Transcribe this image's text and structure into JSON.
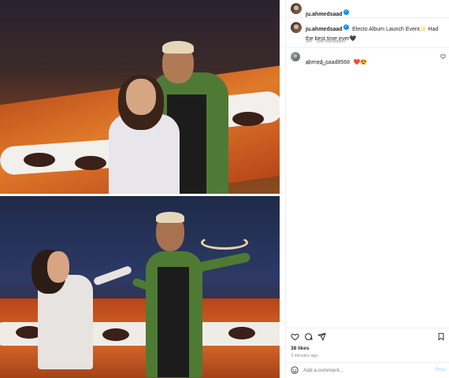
{
  "header": {
    "username": "ju.ahmedsaad",
    "verified": true
  },
  "caption": {
    "username": "ju.ahmedsaad",
    "text": "Electo Album Launch Event",
    "emoji": "✨",
    "text2": " Had the best time ever",
    "emoji2": "🖤",
    "time": "3m",
    "see_translation": "See translation"
  },
  "comments": [
    {
      "username": "ahmed_saad8568",
      "text": "❤️😍",
      "time": "2m",
      "reply": "Reply"
    }
  ],
  "actions": {
    "likes": "38 likes",
    "timestamp": "3 minutes ago"
  },
  "add_comment": {
    "placeholder": "Add a comment...",
    "post_label": "Post"
  },
  "icons": {
    "more": "more-options-icon",
    "heart": "heart-icon",
    "comment": "comment-icon",
    "share": "share-icon",
    "save": "bookmark-icon",
    "emoji": "emoji-icon"
  },
  "colors": {
    "verified": "#0095f6",
    "post_button": "#b2dffc",
    "meta": "#8e8e8e"
  }
}
